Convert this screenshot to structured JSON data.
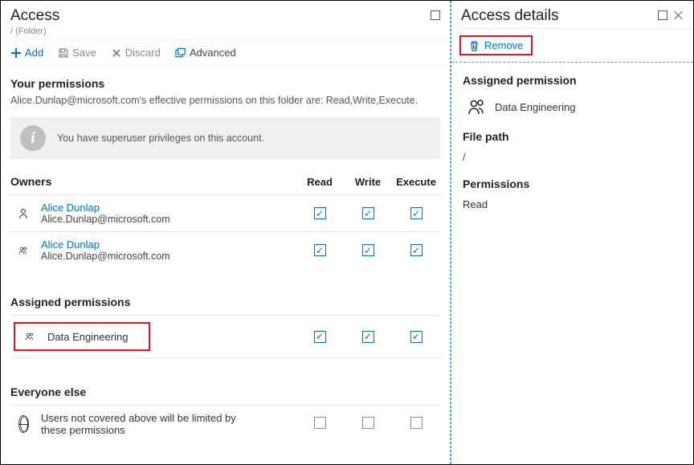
{
  "left": {
    "title": "Access",
    "breadcrumb": "/ (Folder)",
    "toolbar": {
      "add": "Add",
      "save": "Save",
      "discard": "Discard",
      "advanced": "Advanced"
    },
    "yourPermissions": {
      "title": "Your permissions",
      "desc": "Alice.Dunlap@microsoft.com's effective permissions on this folder are: Read,Write,Execute.",
      "info": "You have superuser privileges on this account."
    },
    "cols": {
      "read": "Read",
      "write": "Write",
      "execute": "Execute"
    },
    "ownersTitle": "Owners",
    "owners": [
      {
        "name": "Alice Dunlap",
        "email": "Alice.Dunlap@microsoft.com",
        "read": true,
        "write": true,
        "execute": true,
        "type": "user"
      },
      {
        "name": "Alice Dunlap",
        "email": "Alice.Dunlap@microsoft.com",
        "read": true,
        "write": true,
        "execute": true,
        "type": "group"
      }
    ],
    "assignedTitle": "Assigned permissions",
    "assigned": [
      {
        "name": "Data Engineering",
        "read": true,
        "write": true,
        "execute": true,
        "type": "group",
        "highlight": true
      }
    ],
    "everyoneTitle": "Everyone else",
    "everyone": {
      "text": "Users not covered above will be limited by these permissions",
      "read": false,
      "write": false,
      "execute": false
    }
  },
  "right": {
    "title": "Access details",
    "remove": "Remove",
    "assignedTitle": "Assigned permission",
    "assignedName": "Data Engineering",
    "filePathTitle": "File path",
    "filePath": "/",
    "permTitle": "Permissions",
    "permValue": "Read"
  }
}
